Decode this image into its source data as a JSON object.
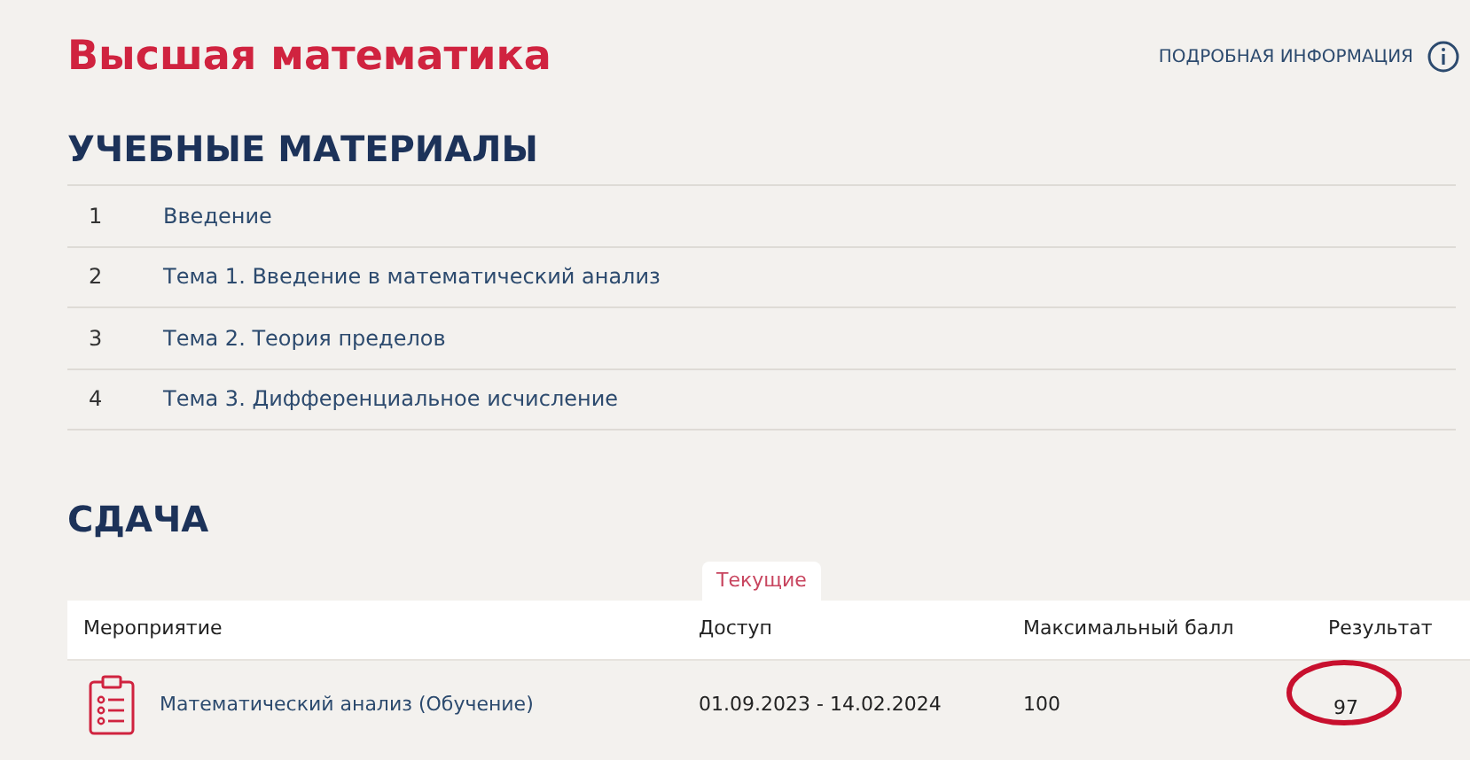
{
  "title": "Высшая математика",
  "info_link": "ПОДРОБНАЯ ИНФОРМАЦИЯ",
  "materials": {
    "heading": "УЧЕБНЫЕ МАТЕРИАЛЫ",
    "items": [
      {
        "number": "1",
        "label": "Введение"
      },
      {
        "number": "2",
        "label": "Тема 1. Введение в математический анализ"
      },
      {
        "number": "3",
        "label": "Тема 2. Теория пределов"
      },
      {
        "number": "4",
        "label": "Тема 3. Дифференциальное исчисление"
      }
    ]
  },
  "submission": {
    "heading": "СДАЧА",
    "tabs": [
      {
        "label": "Текущие",
        "selected": true
      }
    ],
    "table": {
      "columns": [
        "Мероприятие",
        "Доступ",
        "Максимальный балл",
        "Результат"
      ],
      "rows": [
        {
          "event": "Математический анализ (Обучение)",
          "access": "01.09.2023 - 14.02.2024",
          "max_score": "100",
          "result": "97",
          "result_circled": true
        }
      ]
    }
  }
}
